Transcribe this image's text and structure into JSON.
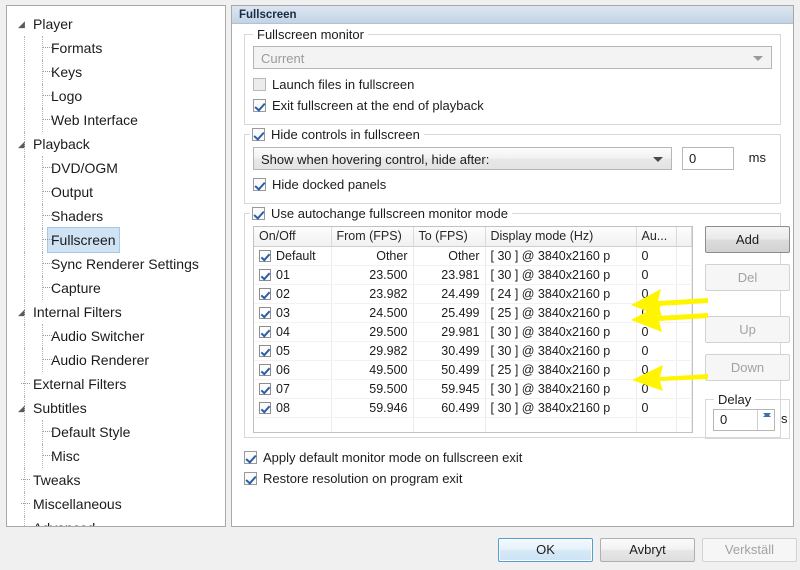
{
  "window": {
    "pane_title": "Fullscreen"
  },
  "sidebar": {
    "items": [
      {
        "label": "Player",
        "level": 0,
        "expander": "◢",
        "selected": false
      },
      {
        "label": "Formats",
        "level": 1,
        "expander": "",
        "selected": false
      },
      {
        "label": "Keys",
        "level": 1,
        "expander": "",
        "selected": false
      },
      {
        "label": "Logo",
        "level": 1,
        "expander": "",
        "selected": false
      },
      {
        "label": "Web Interface",
        "level": 1,
        "expander": "",
        "selected": false
      },
      {
        "label": "Playback",
        "level": 0,
        "expander": "◢",
        "selected": false
      },
      {
        "label": "DVD/OGM",
        "level": 1,
        "expander": "",
        "selected": false
      },
      {
        "label": "Output",
        "level": 1,
        "expander": "",
        "selected": false
      },
      {
        "label": "Shaders",
        "level": 1,
        "expander": "",
        "selected": false
      },
      {
        "label": "Fullscreen",
        "level": 1,
        "expander": "",
        "selected": true
      },
      {
        "label": "Sync Renderer Settings",
        "level": 1,
        "expander": "",
        "selected": false
      },
      {
        "label": "Capture",
        "level": 1,
        "expander": "",
        "selected": false
      },
      {
        "label": "Internal Filters",
        "level": 0,
        "expander": "◢",
        "selected": false
      },
      {
        "label": "Audio Switcher",
        "level": 1,
        "expander": "",
        "selected": false
      },
      {
        "label": "Audio Renderer",
        "level": 1,
        "expander": "",
        "selected": false
      },
      {
        "label": "External Filters",
        "level": 0,
        "expander": "",
        "selected": false
      },
      {
        "label": "Subtitles",
        "level": 0,
        "expander": "◢",
        "selected": false
      },
      {
        "label": "Default Style",
        "level": 1,
        "expander": "",
        "selected": false
      },
      {
        "label": "Misc",
        "level": 1,
        "expander": "",
        "selected": false
      },
      {
        "label": "Tweaks",
        "level": 0,
        "expander": "",
        "selected": false
      },
      {
        "label": "Miscellaneous",
        "level": 0,
        "expander": "",
        "selected": false
      },
      {
        "label": "Advanced",
        "level": 0,
        "expander": "",
        "selected": false
      }
    ]
  },
  "monitor_group": {
    "title": "Fullscreen monitor",
    "combo_value": "Current",
    "launch_fullscreen_label": "Launch files in fullscreen",
    "launch_fullscreen_checked": false,
    "exit_fullscreen_label": "Exit fullscreen at the end of playback",
    "exit_fullscreen_checked": true
  },
  "hide_controls_group": {
    "title": "Hide controls in fullscreen",
    "checked": true,
    "combo_value": "Show when hovering control, hide after:",
    "delay_value": "0",
    "delay_unit": "ms",
    "hide_docked_label": "Hide docked panels",
    "hide_docked_checked": true
  },
  "autochange_group": {
    "title": "Use autochange fullscreen monitor mode",
    "checked": true,
    "table": {
      "columns": [
        "On/Off",
        "From (FPS)",
        "To (FPS)",
        "Display mode (Hz)",
        "Au...",
        ""
      ],
      "rows": [
        {
          "on": true,
          "name": "Default",
          "from": "Other",
          "to": "Other",
          "mode": "[ 30 ] @ 3840x2160 p",
          "au": "0"
        },
        {
          "on": true,
          "name": "01",
          "from": "23.500",
          "to": "23.981",
          "mode": "[ 30 ] @ 3840x2160 p",
          "au": "0"
        },
        {
          "on": true,
          "name": "02",
          "from": "23.982",
          "to": "24.499",
          "mode": "[ 24 ] @ 3840x2160 p",
          "au": "0"
        },
        {
          "on": true,
          "name": "03",
          "from": "24.500",
          "to": "25.499",
          "mode": "[ 25 ] @ 3840x2160 p",
          "au": "0"
        },
        {
          "on": true,
          "name": "04",
          "from": "29.500",
          "to": "29.981",
          "mode": "[ 30 ] @ 3840x2160 p",
          "au": "0"
        },
        {
          "on": true,
          "name": "05",
          "from": "29.982",
          "to": "30.499",
          "mode": "[ 30 ] @ 3840x2160 p",
          "au": "0"
        },
        {
          "on": true,
          "name": "06",
          "from": "49.500",
          "to": "50.499",
          "mode": "[ 25 ] @ 3840x2160 p",
          "au": "0"
        },
        {
          "on": true,
          "name": "07",
          "from": "59.500",
          "to": "59.945",
          "mode": "[ 30 ] @ 3840x2160 p",
          "au": "0"
        },
        {
          "on": true,
          "name": "08",
          "from": "59.946",
          "to": "60.499",
          "mode": "[ 30 ] @ 3840x2160 p",
          "au": "0"
        }
      ]
    },
    "buttons": {
      "add": {
        "label": "Add",
        "enabled": true
      },
      "del": {
        "label": "Del",
        "enabled": false
      },
      "up": {
        "label": "Up",
        "enabled": false
      },
      "down": {
        "label": "Down",
        "enabled": false
      }
    },
    "delay": {
      "title": "Delay",
      "value": "0",
      "unit": "s"
    }
  },
  "bottom_options": {
    "apply_default_label": "Apply default monitor mode on fullscreen exit",
    "apply_default_checked": true,
    "restore_resolution_label": "Restore resolution on program exit",
    "restore_resolution_checked": true
  },
  "footer": {
    "ok_label": "OK",
    "cancel_label": "Avbryt",
    "apply_label": "Verkställ",
    "apply_enabled": false
  },
  "annotations": {
    "color": "#FFF500",
    "arrows": [
      {
        "name": "arrow-rows-02-03",
        "target": "table rows 02 and 03"
      },
      {
        "name": "arrow-row-06",
        "target": "table row 06"
      }
    ]
  }
}
